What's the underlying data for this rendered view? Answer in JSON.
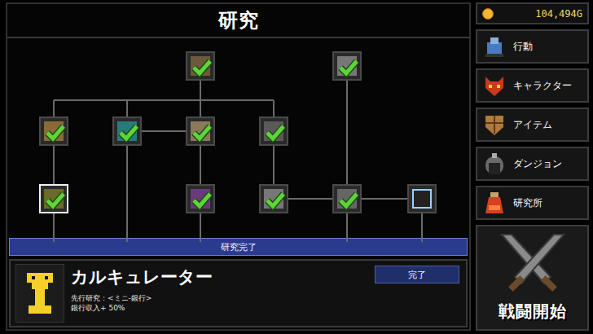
{
  "title": "研究",
  "gold": "104,494G",
  "menu": [
    {
      "label": "行動"
    },
    {
      "label": "キャラクター"
    },
    {
      "label": "アイテム"
    },
    {
      "label": "ダンジョン"
    },
    {
      "label": "研究所"
    }
  ],
  "battle": "戦闘開始",
  "status": "研究完了",
  "nodes": [
    {
      "checked": true,
      "selected": false
    },
    {
      "checked": true,
      "selected": false
    },
    {
      "checked": true,
      "selected": false
    },
    {
      "checked": true,
      "selected": false
    },
    {
      "checked": true,
      "selected": false
    },
    {
      "checked": true,
      "selected": false
    },
    {
      "checked": true,
      "selected": true
    },
    {
      "checked": true,
      "selected": false
    },
    {
      "checked": true,
      "selected": false
    },
    {
      "checked": true,
      "selected": false
    },
    {
      "checked": false,
      "selected": false
    }
  ],
  "detail": {
    "name": "カルキュレーター",
    "button": "完了",
    "prereq": "先行研究：<ミニ-銀行>",
    "effect": "銀行収入+ 50%"
  }
}
